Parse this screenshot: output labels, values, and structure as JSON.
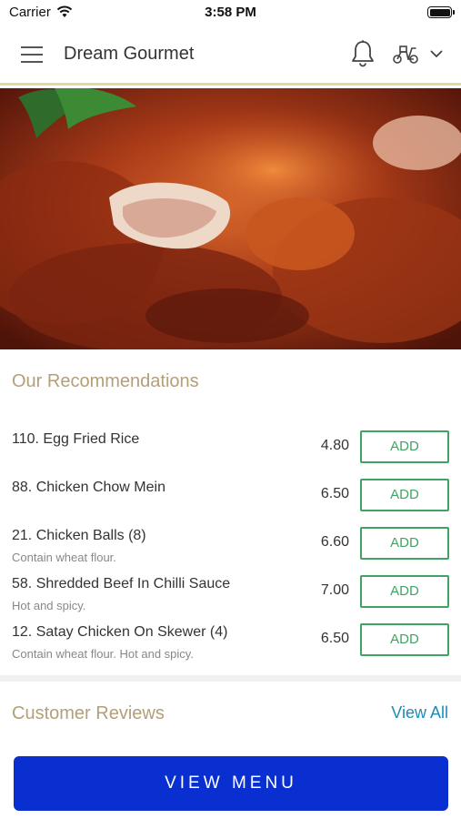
{
  "status_bar": {
    "carrier": "Carrier",
    "time": "3:58 PM"
  },
  "header": {
    "title": "Dream Gourmet",
    "accent_color": "#e7d79d",
    "icons": [
      "menu-icon",
      "bell-icon",
      "scooter-icon",
      "chevron-down-icon"
    ]
  },
  "hero": {
    "icon": "roast-duck-photo"
  },
  "recommendations": {
    "title": "Our Recommendations",
    "items": [
      {
        "name": "110. Egg Fried Rice",
        "description": "",
        "price": "4.80",
        "button": "ADD"
      },
      {
        "name": "88. Chicken Chow Mein",
        "description": "",
        "price": "6.50",
        "button": "ADD"
      },
      {
        "name": "21. Chicken Balls (8)",
        "description": "Contain wheat flour.",
        "price": "6.60",
        "button": "ADD"
      },
      {
        "name": "58. Shredded Beef In Chilli Sauce",
        "description": "Hot and spicy.",
        "price": "7.00",
        "button": "ADD"
      },
      {
        "name": "12. Satay Chicken On Skewer (4)",
        "description": "Contain wheat flour. Hot and spicy.",
        "price": "6.50",
        "button": "ADD"
      }
    ],
    "button_color": "#3fa463"
  },
  "reviews": {
    "title": "Customer Reviews",
    "view_all": "View All",
    "link_color": "#1b8db5"
  },
  "footer": {
    "view_menu": "VIEW MENU",
    "button_color": "#0a2fd0"
  }
}
